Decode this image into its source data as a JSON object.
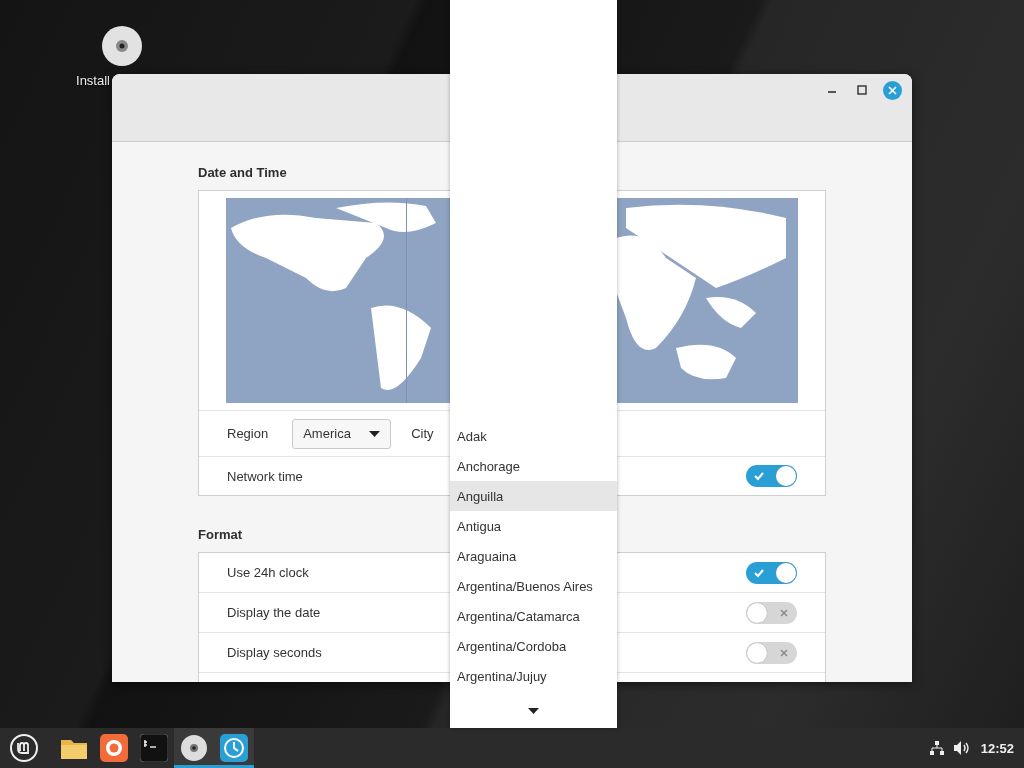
{
  "desktop": {
    "icons": [
      {
        "label": "Install"
      }
    ]
  },
  "window": {
    "sections": [
      {
        "title": "Date and Time",
        "map": {
          "kind": "picture"
        },
        "region": {
          "label": "Region",
          "value": "America"
        },
        "city": {
          "label": "City"
        },
        "rows": [
          {
            "label": "Network time",
            "on": true
          }
        ]
      },
      {
        "title": "Format",
        "rows": [
          {
            "label": "Use 24h clock",
            "on": true
          },
          {
            "label": "Display the date",
            "on": false
          },
          {
            "label": "Display seconds",
            "on": false
          }
        ]
      }
    ]
  },
  "city_list": {
    "items": [
      {
        "label": "Adak",
        "selected": false
      },
      {
        "label": "Anchorage",
        "selected": false
      },
      {
        "label": "Anguilla",
        "selected": true
      },
      {
        "label": "Antigua",
        "selected": false
      },
      {
        "label": "Araguaina",
        "selected": false
      },
      {
        "label": "Argentina/Buenos Aires",
        "selected": false
      },
      {
        "label": "Argentina/Catamarca",
        "selected": false
      },
      {
        "label": "Argentina/Cordoba",
        "selected": false
      },
      {
        "label": "Argentina/Jujuy",
        "selected": false
      }
    ]
  },
  "taskbar": {
    "launchers": [
      {
        "kind": "files",
        "active": false
      },
      {
        "kind": "browser",
        "active": false
      },
      {
        "kind": "terminal",
        "active": false
      },
      {
        "kind": "disc",
        "active": true
      },
      {
        "kind": "clock",
        "active": true
      }
    ],
    "clock": "12:52"
  }
}
